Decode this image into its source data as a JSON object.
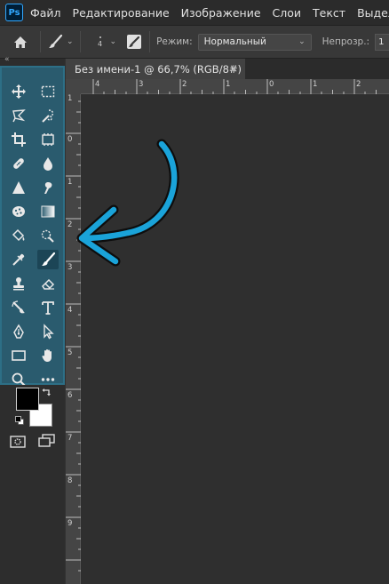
{
  "app": {
    "logo": "Ps"
  },
  "menu": [
    "Файл",
    "Редактирование",
    "Изображение",
    "Слои",
    "Текст",
    "Выделение"
  ],
  "options": {
    "brush_size": "4",
    "mode_label": "Режим:",
    "mode_value": "Нормальный",
    "opacity_label": "Непрозр.:",
    "opacity_value": "1"
  },
  "document": {
    "tab_title": "Без имени-1 @ 66,7% (RGB/8#)",
    "close_glyph": "×"
  },
  "rulers": {
    "top": [
      "4",
      "3",
      "2",
      "1",
      "0",
      "1",
      "2"
    ],
    "left": [
      "1",
      "0",
      "1",
      "2",
      "3",
      "4",
      "5",
      "6",
      "7",
      "8",
      "9"
    ]
  },
  "tools": [
    "move-tool",
    "marquee-tool",
    "lasso-tool",
    "quick-select-tool",
    "crop-tool",
    "frame-tool",
    "healing-tool",
    "blur-tool",
    "triangle-tool",
    "smudge-tool",
    "sponge-tool",
    "gradient-tool",
    "paint-bucket-tool",
    "dodge-tool",
    "eyedropper-tool",
    "brush-tool",
    "stamp-tool",
    "eraser-tool",
    "history-brush-tool",
    "type-tool",
    "pen-tool",
    "path-select-tool",
    "rectangle-tool",
    "hand-tool",
    "zoom-tool",
    "more-tools"
  ],
  "colors": {
    "foreground": "#000000",
    "background": "#ffffff",
    "toolbar_bg": "#2a5b6e",
    "arrow": "#1aa3d9"
  }
}
